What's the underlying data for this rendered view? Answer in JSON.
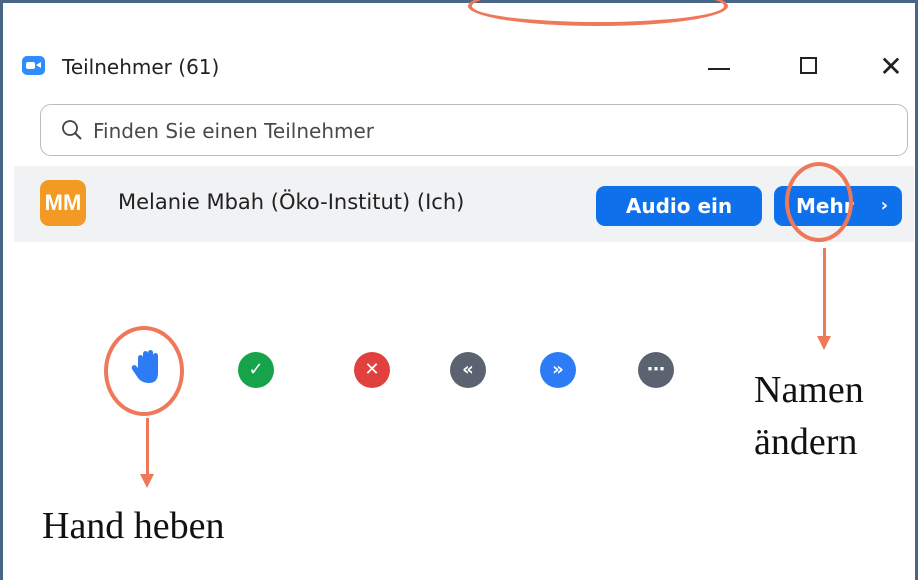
{
  "window": {
    "title": "Teilnehmer (61)",
    "minimize_icon": "minimize-icon",
    "maximize_icon": "maximize-icon",
    "close_icon": "close-icon",
    "close_glyph": "✕"
  },
  "search": {
    "placeholder": "Finden Sie einen Teilnehmer",
    "value": ""
  },
  "participant": {
    "initials": "MM",
    "name": "Melanie Mbah (Öko-Institut) (Ich)",
    "avatar_color": "#f29a24",
    "audio_button": "Audio ein",
    "more_button": "Mehr",
    "more_chevron": "›"
  },
  "reactions": [
    {
      "name": "raise-hand",
      "icon": "hand-icon",
      "color": "#2d7cf6"
    },
    {
      "name": "yes",
      "icon": "check-icon",
      "color": "#17a34a",
      "glyph": "✓"
    },
    {
      "name": "no",
      "icon": "x-icon",
      "color": "#e0403e",
      "glyph": "✕"
    },
    {
      "name": "go-slower",
      "icon": "rewind-icon",
      "color": "#5b6270",
      "glyph": "«"
    },
    {
      "name": "go-faster",
      "icon": "fast-forward-icon",
      "color": "#2d7cf6",
      "glyph": "»"
    },
    {
      "name": "more",
      "icon": "ellipsis-icon",
      "color": "#5b6270",
      "glyph": "⋯"
    }
  ],
  "annotations": {
    "rename_label_line1": "Namen",
    "rename_label_line2": "ändern",
    "raise_hand_label": "Hand heben",
    "highlight_color": "#f0785a"
  },
  "colors": {
    "accent": "#0e71eb",
    "frame": "#4a6687",
    "row_background": "#f1f2f4"
  }
}
